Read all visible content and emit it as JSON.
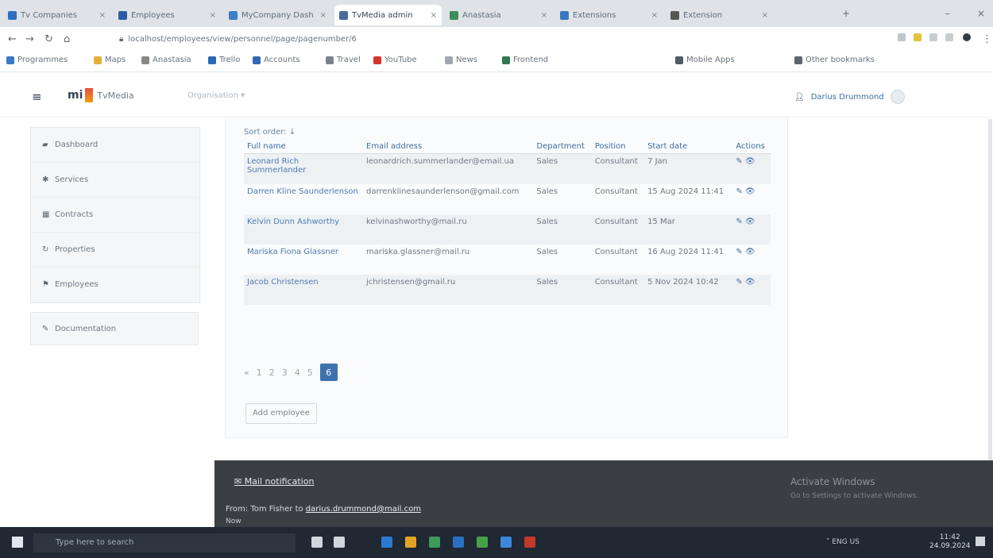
{
  "browser": {
    "tabs": [
      {
        "label": "Tv Companies",
        "color": "#2f6fbf"
      },
      {
        "label": "Employees",
        "color": "#2b5da0"
      },
      {
        "label": "MyCompany Dash",
        "color": "#3e7dc7"
      },
      {
        "label": "TvMedia admin",
        "color": "#4a6a9a"
      },
      {
        "label": "Anastasia",
        "color": "#3c8d5a"
      },
      {
        "label": "Extensions",
        "color": "#3a78c0"
      },
      {
        "label": "Extension",
        "color": "#555555"
      }
    ],
    "url": "localhost/employees/view/personnel/page/pagenumber/6",
    "bookmarks": [
      {
        "label": "Programmes",
        "color": "#3b79c4"
      },
      {
        "label": "Maps",
        "color": "#e2b13c"
      },
      {
        "label": "Anastasia",
        "color": "#888888"
      },
      {
        "label": "Trello",
        "color": "#2a6ab0"
      },
      {
        "label": "Accounts",
        "color": "#3568b3"
      },
      {
        "label": "Travel",
        "color": "#7a8290"
      },
      {
        "label": "YouTube",
        "color": "#d8342a"
      },
      {
        "label": "News",
        "color": "#a0a7ae"
      },
      {
        "label": "Frontend",
        "color": "#2f7a52"
      },
      {
        "label": "Mobile Apps",
        "color": "#4f5b66"
      },
      {
        "label": "Other bookmarks",
        "color": "#5c6670"
      }
    ]
  },
  "app": {
    "logo_mark": "mi",
    "logo_text": "TvMedia",
    "context_selector": "Organisation",
    "user_name": "Darius Drummond"
  },
  "sidebar": {
    "items": [
      {
        "label": "Dashboard",
        "icon": "gauge-icon"
      },
      {
        "label": "Services",
        "icon": "gear-icon"
      },
      {
        "label": "Contracts",
        "icon": "calendar-icon"
      },
      {
        "label": "Properties",
        "icon": "refresh-icon"
      },
      {
        "label": "Employees",
        "icon": "users-icon"
      }
    ],
    "secondary": {
      "label": "Documentation",
      "icon": "wrench-icon"
    }
  },
  "main": {
    "sort_note": "Sort order: ↓",
    "columns": [
      "Full name",
      "Email address",
      "Department",
      "Position",
      "Start date",
      "Actions"
    ],
    "rows": [
      {
        "name": "Leonard Rich Summerlander",
        "email": "leonardrich.summerlander@email.ua",
        "dept": "Sales",
        "position": "Consultant",
        "date": "7 Jan"
      },
      {
        "name": "Darren Kline Saunderlenson",
        "email": "darrenklinesaunderlenson@gmail.com",
        "dept": "Sales",
        "position": "Consultant",
        "date": "15 Aug 2024 11:41"
      },
      {
        "name": "Kelvin Dunn Ashworthy",
        "email": "kelvinashworthy@mail.ru",
        "dept": "Sales",
        "position": "Consultant",
        "date": "15 Mar"
      },
      {
        "name": "Mariska Fiona Glassner",
        "email": "mariska.glassner@mail.ru",
        "dept": "Sales",
        "position": "Consultant",
        "date": "16 Aug 2024 11:41"
      },
      {
        "name": "Jacob Christensen",
        "email": "jchristensen@gmail.ru",
        "dept": "Sales",
        "position": "Consultant",
        "date": "5 Nov 2024 10:42"
      }
    ],
    "row_actions": "✎ 👁",
    "pages": [
      "«",
      "1",
      "2",
      "3",
      "4",
      "5"
    ],
    "current_page": "6",
    "add_button": "Add employee"
  },
  "notification": {
    "title": "Mail notification",
    "line_prefix": "From: Tom Fisher to",
    "line_link": "darius.drummond@mail.com",
    "footer": "Now",
    "activate_title": "Activate Windows",
    "activate_sub": "Go to Settings to activate Windows."
  },
  "taskbar": {
    "search_placeholder": "Type here to search",
    "tray": "ENG US",
    "time": "11:42",
    "date": "24.09.2024",
    "pinned": [
      "#2e7ad1",
      "#e0a526",
      "#3c9a5a",
      "#2a6fc0",
      "#44a24a",
      "#3d87d8",
      "#c0392b"
    ]
  }
}
